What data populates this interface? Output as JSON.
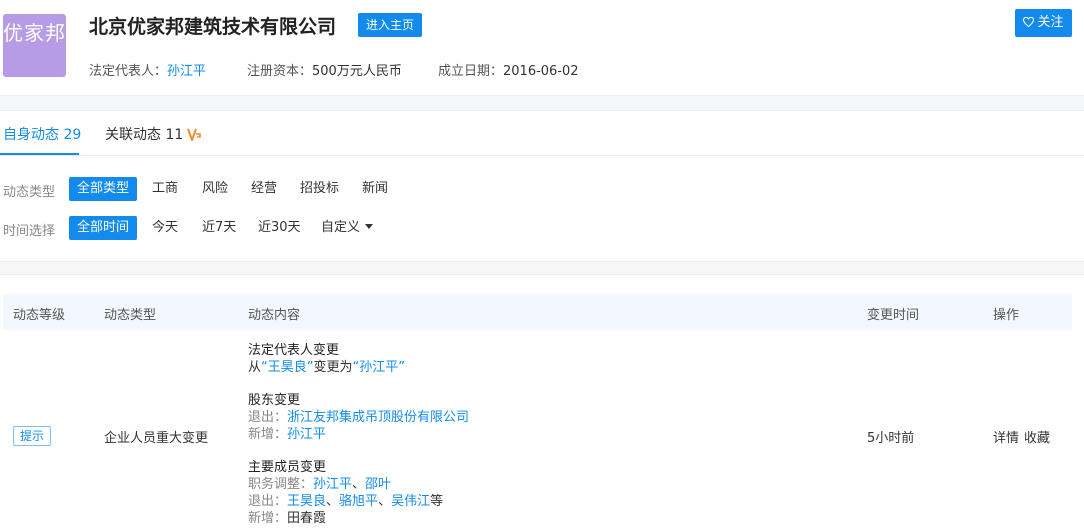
{
  "header": {
    "logo_text": "优家邦",
    "company_name": "北京优家邦建筑技术有限公司",
    "enter_label": "进入主页",
    "follow_label": "关注",
    "legal_rep_label": "法定代表人：",
    "legal_rep_value": "孙江平",
    "capital_label": "注册资本：",
    "capital_value": "500万元人民币",
    "founded_label": "成立日期：",
    "founded_value": "2016-06-02"
  },
  "tabs": [
    {
      "label": "自身动态 29",
      "active": true
    },
    {
      "label": "关联动态 11",
      "active": false
    }
  ],
  "filters": {
    "type_label": "动态类型",
    "type_options": [
      "全部类型",
      "工商",
      "风险",
      "经营",
      "招投标",
      "新闻"
    ],
    "time_label": "时间选择",
    "time_options": [
      "全部时间",
      "今天",
      "近7天",
      "近30天",
      "自定义"
    ]
  },
  "table": {
    "columns": [
      "动态等级",
      "动态类型",
      "动态内容",
      "变更时间",
      "操作"
    ],
    "row": {
      "level": "提示",
      "type": "企业人员重大变更",
      "time": "5小时前",
      "actions": [
        "详情",
        "收藏"
      ],
      "content": {
        "legal": {
          "title": "法定代表人变更",
          "from_prefix": "从",
          "from_name": "“王昊良”",
          "middle": "变更为",
          "to_name": "“孙江平”"
        },
        "shareholder": {
          "title": "股东变更",
          "exit_label": "退出：",
          "exit_value": "浙江友邦集成吊顶股份有限公司",
          "add_label": "新增：",
          "add_value": "孙江平"
        },
        "members": {
          "title": "主要成员变更",
          "adjust_label": "职务调整：",
          "adjust_1": "孙江平",
          "sep": "、",
          "adjust_2": "邵叶",
          "exit_label": "退出：",
          "exit_1": "王昊良",
          "exit_2": "骆旭平",
          "exit_3": "吴伟江",
          "exit_suffix": "等",
          "add_label": "新增：",
          "add_value": "田春霞"
        }
      }
    }
  }
}
